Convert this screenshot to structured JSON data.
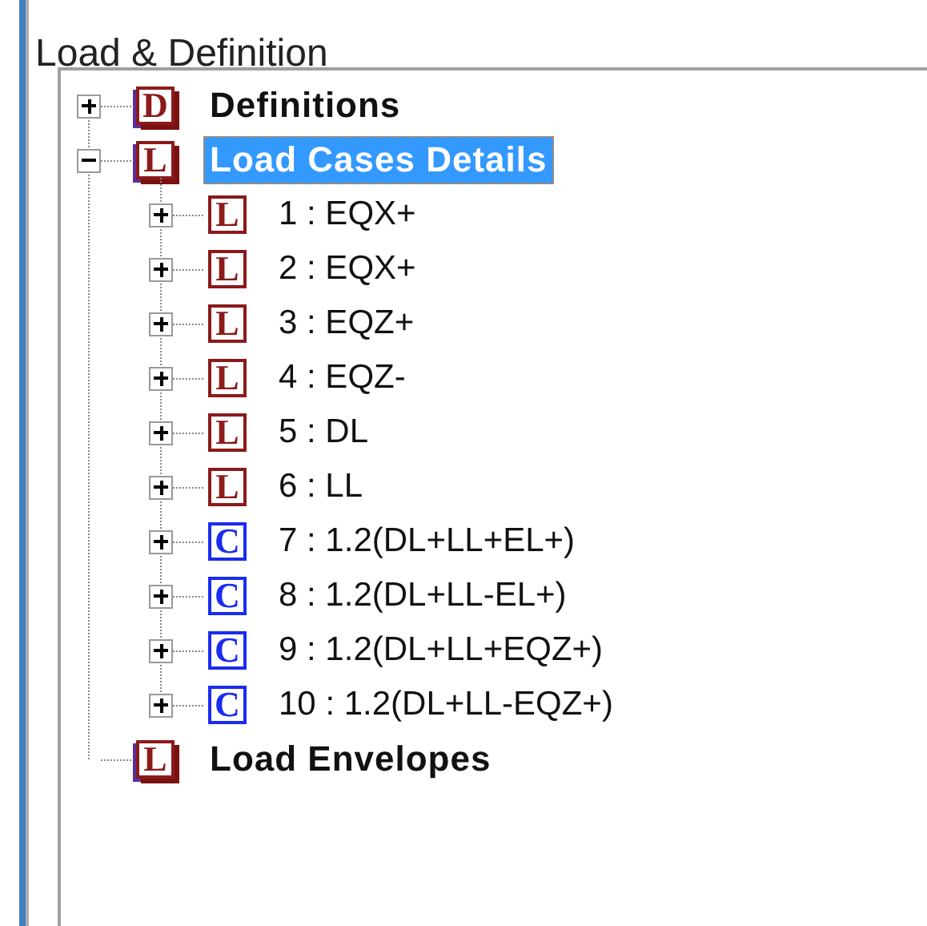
{
  "window": {
    "title": "Load & Definition"
  },
  "tree": [
    {
      "label": "Definitions",
      "badge": "D",
      "kind": "load",
      "stacked": true,
      "expandable": true,
      "expanded": false,
      "selected": false
    },
    {
      "label": "Load Cases Details",
      "badge": "L",
      "kind": "load",
      "stacked": true,
      "expandable": true,
      "expanded": true,
      "selected": true,
      "children": [
        {
          "label": "1 : EQX+",
          "badge": "L",
          "kind": "load",
          "stacked": false,
          "expandable": true,
          "expanded": false,
          "selected": false
        },
        {
          "label": "2 : EQX+",
          "badge": "L",
          "kind": "load",
          "stacked": false,
          "expandable": true,
          "expanded": false,
          "selected": false
        },
        {
          "label": "3 : EQZ+",
          "badge": "L",
          "kind": "load",
          "stacked": false,
          "expandable": true,
          "expanded": false,
          "selected": false
        },
        {
          "label": "4 : EQZ-",
          "badge": "L",
          "kind": "load",
          "stacked": false,
          "expandable": true,
          "expanded": false,
          "selected": false
        },
        {
          "label": "5 : DL",
          "badge": "L",
          "kind": "load",
          "stacked": false,
          "expandable": true,
          "expanded": false,
          "selected": false
        },
        {
          "label": "6 : LL",
          "badge": "L",
          "kind": "load",
          "stacked": false,
          "expandable": true,
          "expanded": false,
          "selected": false
        },
        {
          "label": "7 : 1.2(DL+LL+EL+)",
          "badge": "C",
          "kind": "combination",
          "stacked": false,
          "expandable": true,
          "expanded": false,
          "selected": false
        },
        {
          "label": "8 : 1.2(DL+LL-EL+)",
          "badge": "C",
          "kind": "combination",
          "stacked": false,
          "expandable": true,
          "expanded": false,
          "selected": false
        },
        {
          "label": "9 : 1.2(DL+LL+EQZ+)",
          "badge": "C",
          "kind": "combination",
          "stacked": false,
          "expandable": true,
          "expanded": false,
          "selected": false
        },
        {
          "label": "10 : 1.2(DL+LL-EQZ+)",
          "badge": "C",
          "kind": "combination",
          "stacked": false,
          "expandable": true,
          "expanded": false,
          "selected": false
        }
      ]
    },
    {
      "label": "Load Envelopes",
      "badge": "L",
      "kind": "load",
      "stacked": true,
      "expandable": false,
      "selected": false
    }
  ]
}
